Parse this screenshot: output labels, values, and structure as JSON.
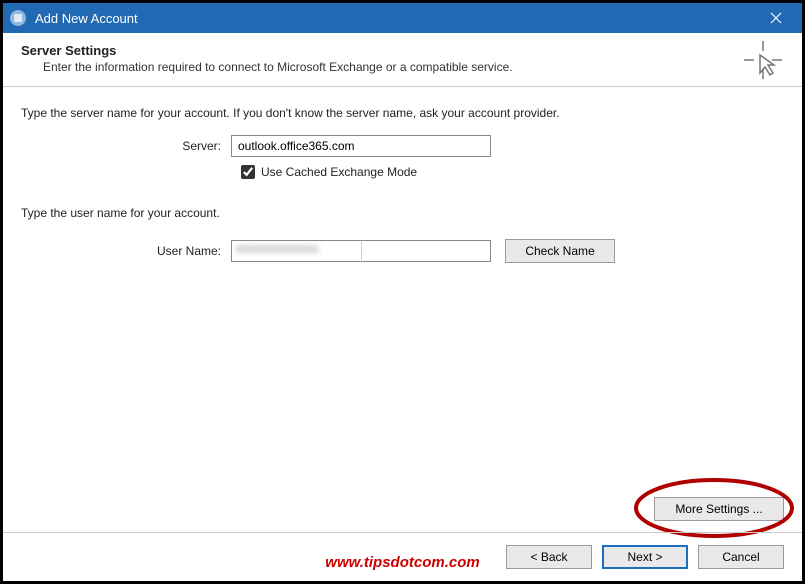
{
  "titlebar": {
    "title": "Add New Account"
  },
  "header": {
    "heading": "Server Settings",
    "subheading": "Enter the information required to connect to Microsoft Exchange or a compatible service."
  },
  "server_section": {
    "instruction": "Type the server name for your account. If you don't know the server name, ask your account provider.",
    "server_label": "Server:",
    "server_value": "outlook.office365.com",
    "cached_label": "Use Cached Exchange Mode",
    "cached_checked": true
  },
  "user_section": {
    "instruction": "Type the user name for your account.",
    "user_label": "User Name:",
    "user_value": "",
    "check_name_label": "Check Name"
  },
  "more_settings_label": "More Settings ...",
  "footer": {
    "back_label": "< Back",
    "next_label": "Next >",
    "cancel_label": "Cancel"
  },
  "watermark": "www.tipsdotcom.com"
}
